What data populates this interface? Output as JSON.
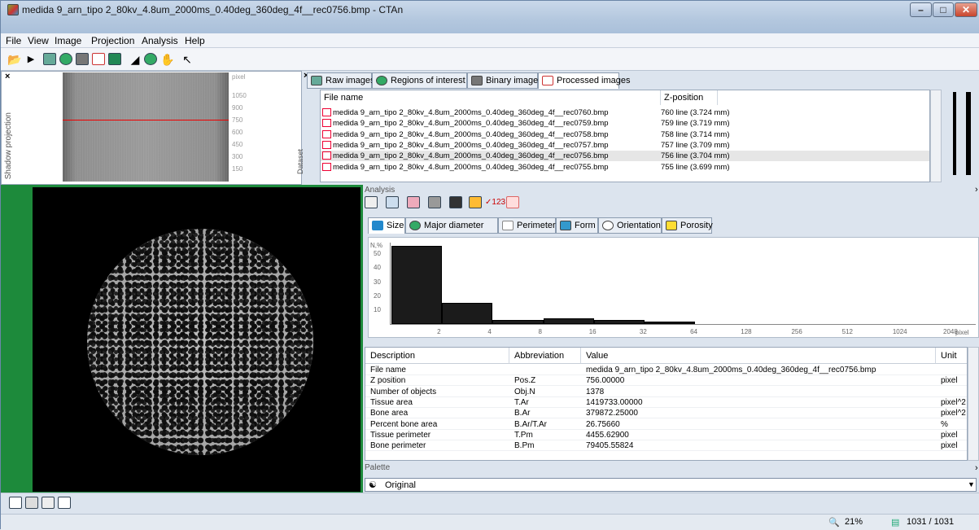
{
  "window": {
    "title": "medida 9_arn_tipo 2_80kv_4.8um_2000ms_0.40deg_360deg_4f__rec0756.bmp - CTAn",
    "controls": {
      "minimize": "–",
      "maximize": "□",
      "close": "✕"
    }
  },
  "menu": [
    "File",
    "View",
    "Image",
    "Projection",
    "Analysis",
    "Help"
  ],
  "shadow_projection": {
    "label": "Shadow projection",
    "unit": "pixel",
    "scale": [
      "1050",
      "900",
      "750",
      "600",
      "450",
      "300",
      "150"
    ],
    "close": "×"
  },
  "dataset": {
    "label": "Dataset",
    "close": "×",
    "tabs": [
      "Raw images",
      "Regions of interest",
      "Binary images",
      "Processed images"
    ],
    "columns": {
      "file": "File name",
      "z": "Z-position"
    },
    "rows": [
      {
        "name": "medida 9_arn_tipo 2_80kv_4.8um_2000ms_0.40deg_360deg_4f__rec0760.bmp",
        "z": "760 line (3.724 mm)"
      },
      {
        "name": "medida 9_arn_tipo 2_80kv_4.8um_2000ms_0.40deg_360deg_4f__rec0759.bmp",
        "z": "759 line (3.719 mm)"
      },
      {
        "name": "medida 9_arn_tipo 2_80kv_4.8um_2000ms_0.40deg_360deg_4f__rec0758.bmp",
        "z": "758 line (3.714 mm)"
      },
      {
        "name": "medida 9_arn_tipo 2_80kv_4.8um_2000ms_0.40deg_360deg_4f__rec0757.bmp",
        "z": "757 line (3.709 mm)"
      },
      {
        "name": "medida 9_arn_tipo 2_80kv_4.8um_2000ms_0.40deg_360deg_4f__rec0756.bmp",
        "z": "756 line (3.704 mm)"
      },
      {
        "name": "medida 9_arn_tipo 2_80kv_4.8um_2000ms_0.40deg_360deg_4f__rec0755.bmp",
        "z": "755 line (3.699 mm)"
      }
    ],
    "selected_index": 4
  },
  "analysis": {
    "label": "Analysis",
    "collapse": "›",
    "tool_text": [
      "✓123"
    ],
    "tabs": [
      "Size",
      "Major diameter",
      "Perimeter",
      "Form",
      "Orientation",
      "Porosity"
    ],
    "histogram": {
      "ylabel": "N,%",
      "yticks": [
        "50",
        "40",
        "30",
        "20",
        "10"
      ],
      "xticks": [
        "2",
        "4",
        "8",
        "16",
        "32",
        "64",
        "128",
        "256",
        "512",
        "1024",
        "2048"
      ],
      "xunit": "pixel",
      "bin_edges": [
        1,
        2,
        4,
        8,
        16,
        32,
        64
      ],
      "values": [
        56,
        15,
        3,
        4,
        3,
        2
      ],
      "ymax": 56
    },
    "table": {
      "headers": [
        "Description",
        "Abbreviation",
        "Value",
        "Unit"
      ],
      "rows": [
        [
          "File name",
          "",
          "medida 9_arn_tipo 2_80kv_4.8um_2000ms_0.40deg_360deg_4f__rec0756.bmp",
          ""
        ],
        [
          "Z position",
          "Pos.Z",
          "756.00000",
          "pixel"
        ],
        [
          "Number of objects",
          "Obj.N",
          "1378",
          ""
        ],
        [
          "Tissue area",
          "T.Ar",
          "1419733.00000",
          "pixel^2"
        ],
        [
          "Bone area",
          "B.Ar",
          "379872.25000",
          "pixel^2"
        ],
        [
          "Percent bone area",
          "B.Ar/T.Ar",
          "26.75660",
          "%"
        ],
        [
          "Tissue perimeter",
          "T.Pm",
          "4455.62900",
          "pixel"
        ],
        [
          "Bone perimeter",
          "B.Pm",
          "79405.55824",
          "pixel"
        ]
      ]
    }
  },
  "palette": {
    "label": "Palette",
    "value": "Original",
    "collapse": "›"
  },
  "status": {
    "zoom": "21%",
    "slice": "1031 / 1031"
  },
  "colors": {
    "accent_green": "#1d8a3b",
    "red_line": "#e00000"
  }
}
